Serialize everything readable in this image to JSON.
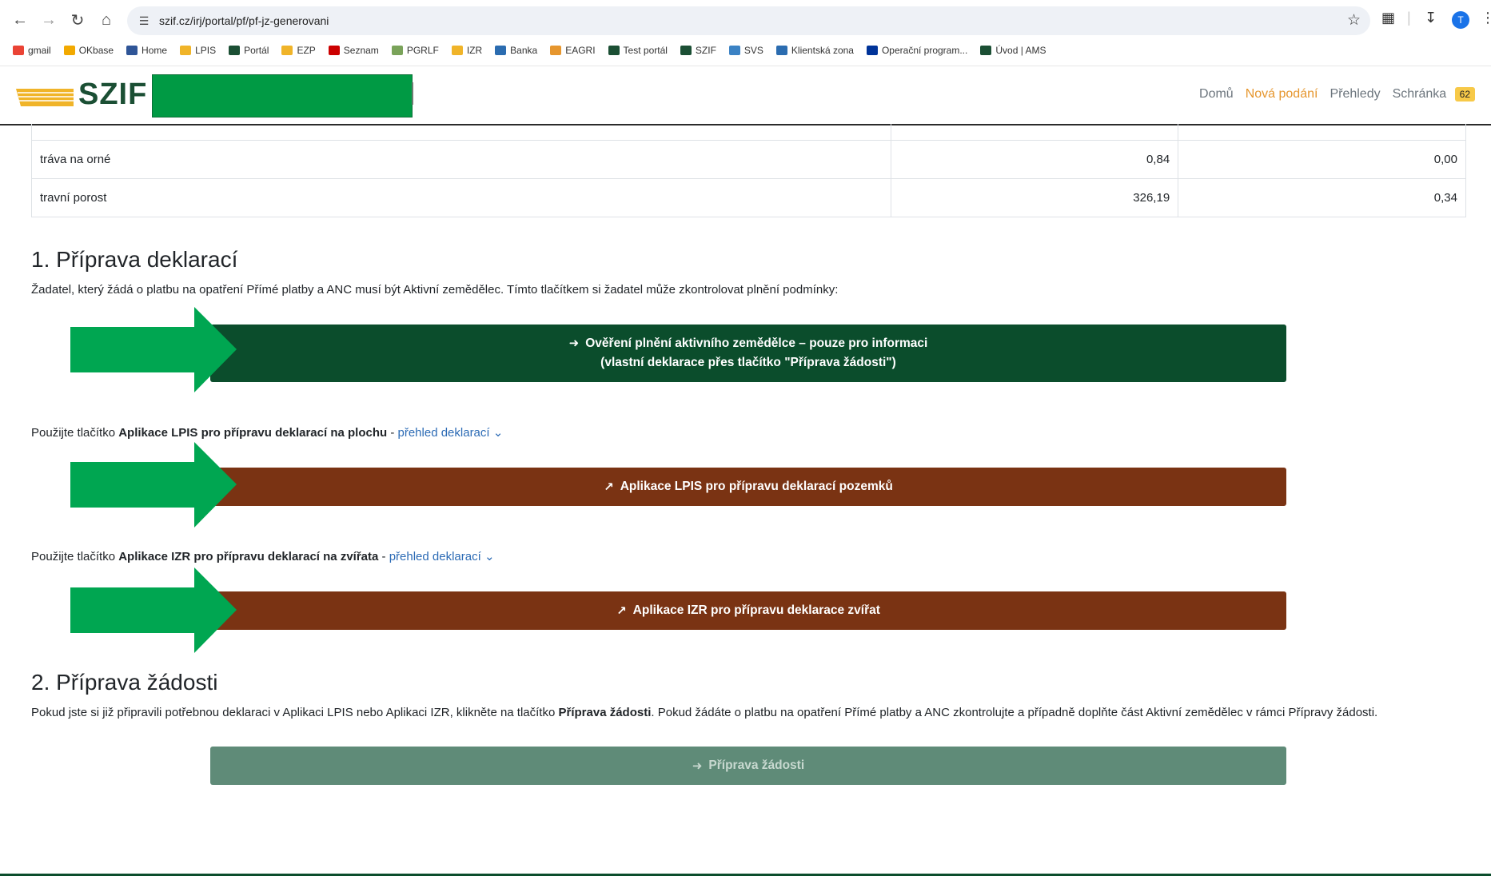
{
  "browser": {
    "url": "szif.cz/irj/portal/pf/pf-jz-generovani",
    "profile_initial": "T",
    "bookmarks": [
      {
        "label": "gmail",
        "color": "#ea4335"
      },
      {
        "label": "OKbase",
        "color": "#f2a900"
      },
      {
        "label": "Home",
        "color": "#2f5597"
      },
      {
        "label": "LPIS",
        "color": "#f0b429"
      },
      {
        "label": "Portál",
        "color": "#1b4f34"
      },
      {
        "label": "EZP",
        "color": "#f0b429"
      },
      {
        "label": "Seznam",
        "color": "#cc0000"
      },
      {
        "label": "PGRLF",
        "color": "#7aa35a"
      },
      {
        "label": "IZR",
        "color": "#f0b429"
      },
      {
        "label": "Banka",
        "color": "#2b6cb0"
      },
      {
        "label": "EAGRI",
        "color": "#e6962e"
      },
      {
        "label": "Test portál",
        "color": "#1b4f34"
      },
      {
        "label": "SZIF",
        "color": "#1b4f34"
      },
      {
        "label": "SVS",
        "color": "#3b82c4"
      },
      {
        "label": "Klientská zona",
        "color": "#2b6cb0"
      },
      {
        "label": "Operační program...",
        "color": "#003399"
      },
      {
        "label": "Úvod | AMS",
        "color": "#1b4f34"
      }
    ]
  },
  "header": {
    "logo_text": "SZIF",
    "menu": [
      {
        "label": "Domů",
        "active": false
      },
      {
        "label": "Nová podání",
        "active": true
      },
      {
        "label": "Přehledy",
        "active": false
      },
      {
        "label": "Schránka",
        "active": false
      }
    ],
    "inbox_count": "62"
  },
  "table": {
    "rows": [
      {
        "name": "tráva na orné",
        "v1": "0,84",
        "v2": "0,00"
      },
      {
        "name": "travní porost",
        "v1": "326,19",
        "v2": "0,34"
      }
    ]
  },
  "section1": {
    "title": "1. Příprava deklarací",
    "intro": "Žadatel, který žádá o platbu na opatření Přímé platby a ANC musí být Aktivní zemědělec. Tímto tlačítkem si žadatel může zkontrolovat plnění podmínky:",
    "verify_button_line1": "Ověření plnění aktivního zemědělce – pouze pro informaci",
    "verify_button_line2": "(vlastní deklarace přes tlačítko \"Příprava žádosti\")",
    "lpis_text_pre": "Použijte tlačítko ",
    "lpis_text_bold": "Aplikace LPIS pro přípravu deklarací na plochu",
    "lpis_text_sep": " - ",
    "lpis_link": "přehled deklarací",
    "lpis_button": "Aplikace LPIS pro přípravu deklarací pozemků",
    "izr_text_pre": "Použijte tlačítko ",
    "izr_text_bold": "Aplikace IZR pro přípravu deklarací na zvířata",
    "izr_text_sep": " - ",
    "izr_link": "přehled deklarací",
    "izr_button": "Aplikace IZR pro přípravu deklarace zvířat"
  },
  "section2": {
    "title": "2. Příprava žádosti",
    "text_pre": "Pokud jste si již připravili potřebnou deklaraci v Aplikaci LPIS nebo Aplikaci IZR, klikněte na tlačítko ",
    "text_bold": "Příprava žádosti",
    "text_post": ". Pokud žádáte o platbu na opatření Přímé platby a ANC zkontrolujte a případně doplňte část Aktivní zemědělec v rámci Přípravy žádosti.",
    "button": "Příprava žádosti"
  },
  "colors": {
    "green_button": "#0b4d2c",
    "brown_button": "#7a3313",
    "disabled_button": "#5f8b78",
    "arrow_fill": "#00a651",
    "accent_orange": "#e6962e"
  }
}
